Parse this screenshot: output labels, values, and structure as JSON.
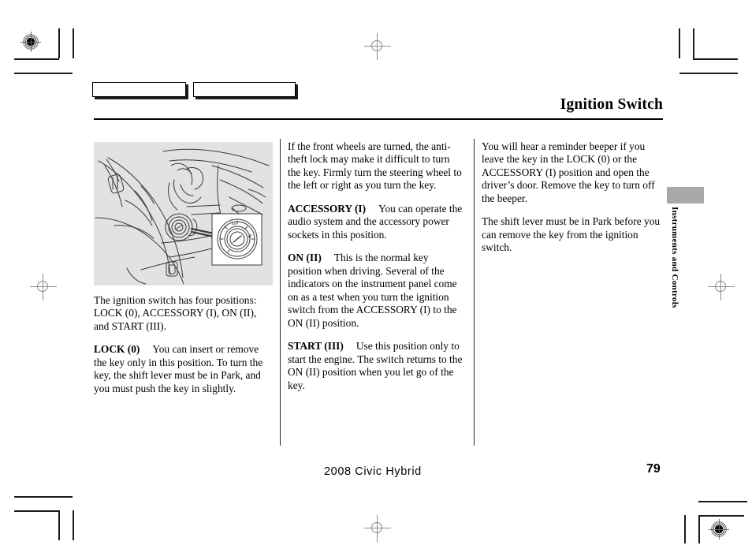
{
  "document": {
    "title": "Ignition Switch",
    "footer_model": "2008  Civic  Hybrid",
    "page_number": "79",
    "side_tab_label": "Instruments and Controls"
  },
  "header": {
    "tab_box_left": "",
    "tab_box_right": ""
  },
  "figure": {
    "caption": "",
    "alt": "Driver side interior view showing steering wheel, dashboard and ignition switch with inset detail of the key cylinder"
  },
  "columns": {
    "col1": [
      {
        "heading": "",
        "text": "The ignition switch has four positions: LOCK (0), ACCESSORY (I), ON (II), and START (III)."
      },
      {
        "heading": "LOCK (0)",
        "text": "You can insert or remove the key only in this position. To turn the key, the shift lever must be in Park, and you must push the key in slightly."
      }
    ],
    "col2": [
      {
        "heading": "",
        "text": "If the front wheels are turned, the anti-theft lock may make it difficult to turn the key. Firmly turn the steering wheel to the left or right as you turn the key."
      },
      {
        "heading": "ACCESSORY (I)",
        "text": "You can operate the audio system and the accessory power sockets in this position."
      },
      {
        "heading": "ON (II)",
        "text": "This is the normal key position when driving. Several of the indicators on the instrument panel come on as a test when you turn the ignition switch from the ACCESSORY (I) to the ON (II) position."
      },
      {
        "heading": "START (III)",
        "text": "Use this position only to start the engine. The switch returns to the ON (II) position when you let go of the key."
      }
    ],
    "col3": [
      {
        "heading": "",
        "text": "You will hear a reminder beeper if you leave the key in the LOCK (0) or the ACCESSORY (I) position and open the driver’s door. Remove the key to turn off the beeper."
      },
      {
        "heading": "",
        "text": "The shift lever must be in Park before you can remove the key from the ignition switch."
      }
    ]
  },
  "colors": {
    "figure_background": "#e2e2e2",
    "side_tab_block": "#a8a8a8",
    "rule": "#000000"
  }
}
